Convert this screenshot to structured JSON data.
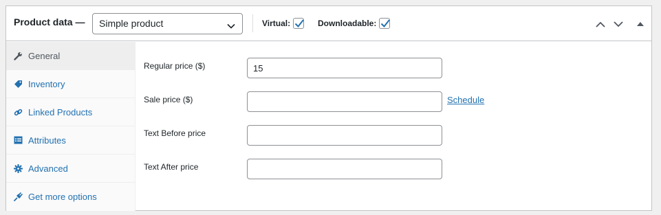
{
  "header": {
    "title": "Product data —",
    "product_type": {
      "selected": "Simple product",
      "icon": "chevron-down-icon"
    },
    "virtual": {
      "label": "Virtual:",
      "checked": true
    },
    "downloadable": {
      "label": "Downloadable:",
      "checked": true
    },
    "controls": [
      "move-up-icon",
      "move-down-icon",
      "collapse-toggle-icon"
    ]
  },
  "tabs": [
    {
      "label": "General",
      "icon": "wrench-icon",
      "active": true
    },
    {
      "label": "Inventory",
      "icon": "tag-icon",
      "active": false
    },
    {
      "label": "Linked Products",
      "icon": "link-icon",
      "active": false
    },
    {
      "label": "Attributes",
      "icon": "list-table-icon",
      "active": false
    },
    {
      "label": "Advanced",
      "icon": "gear-icon",
      "active": false
    },
    {
      "label": "Get more options",
      "icon": "plugin-icon",
      "active": false
    }
  ],
  "general": {
    "regular_price": {
      "label": "Regular price ($)",
      "value": "15"
    },
    "sale_price": {
      "label": "Sale price ($)",
      "value": "",
      "link": "Schedule"
    },
    "text_before": {
      "label": "Text Before price",
      "value": ""
    },
    "text_after": {
      "label": "Text After price",
      "value": ""
    }
  },
  "colors": {
    "link": "#2271b1",
    "border": "#c3c4c7",
    "checkmark": "#2271b1",
    "active_tab_bg": "#eeeeee"
  }
}
